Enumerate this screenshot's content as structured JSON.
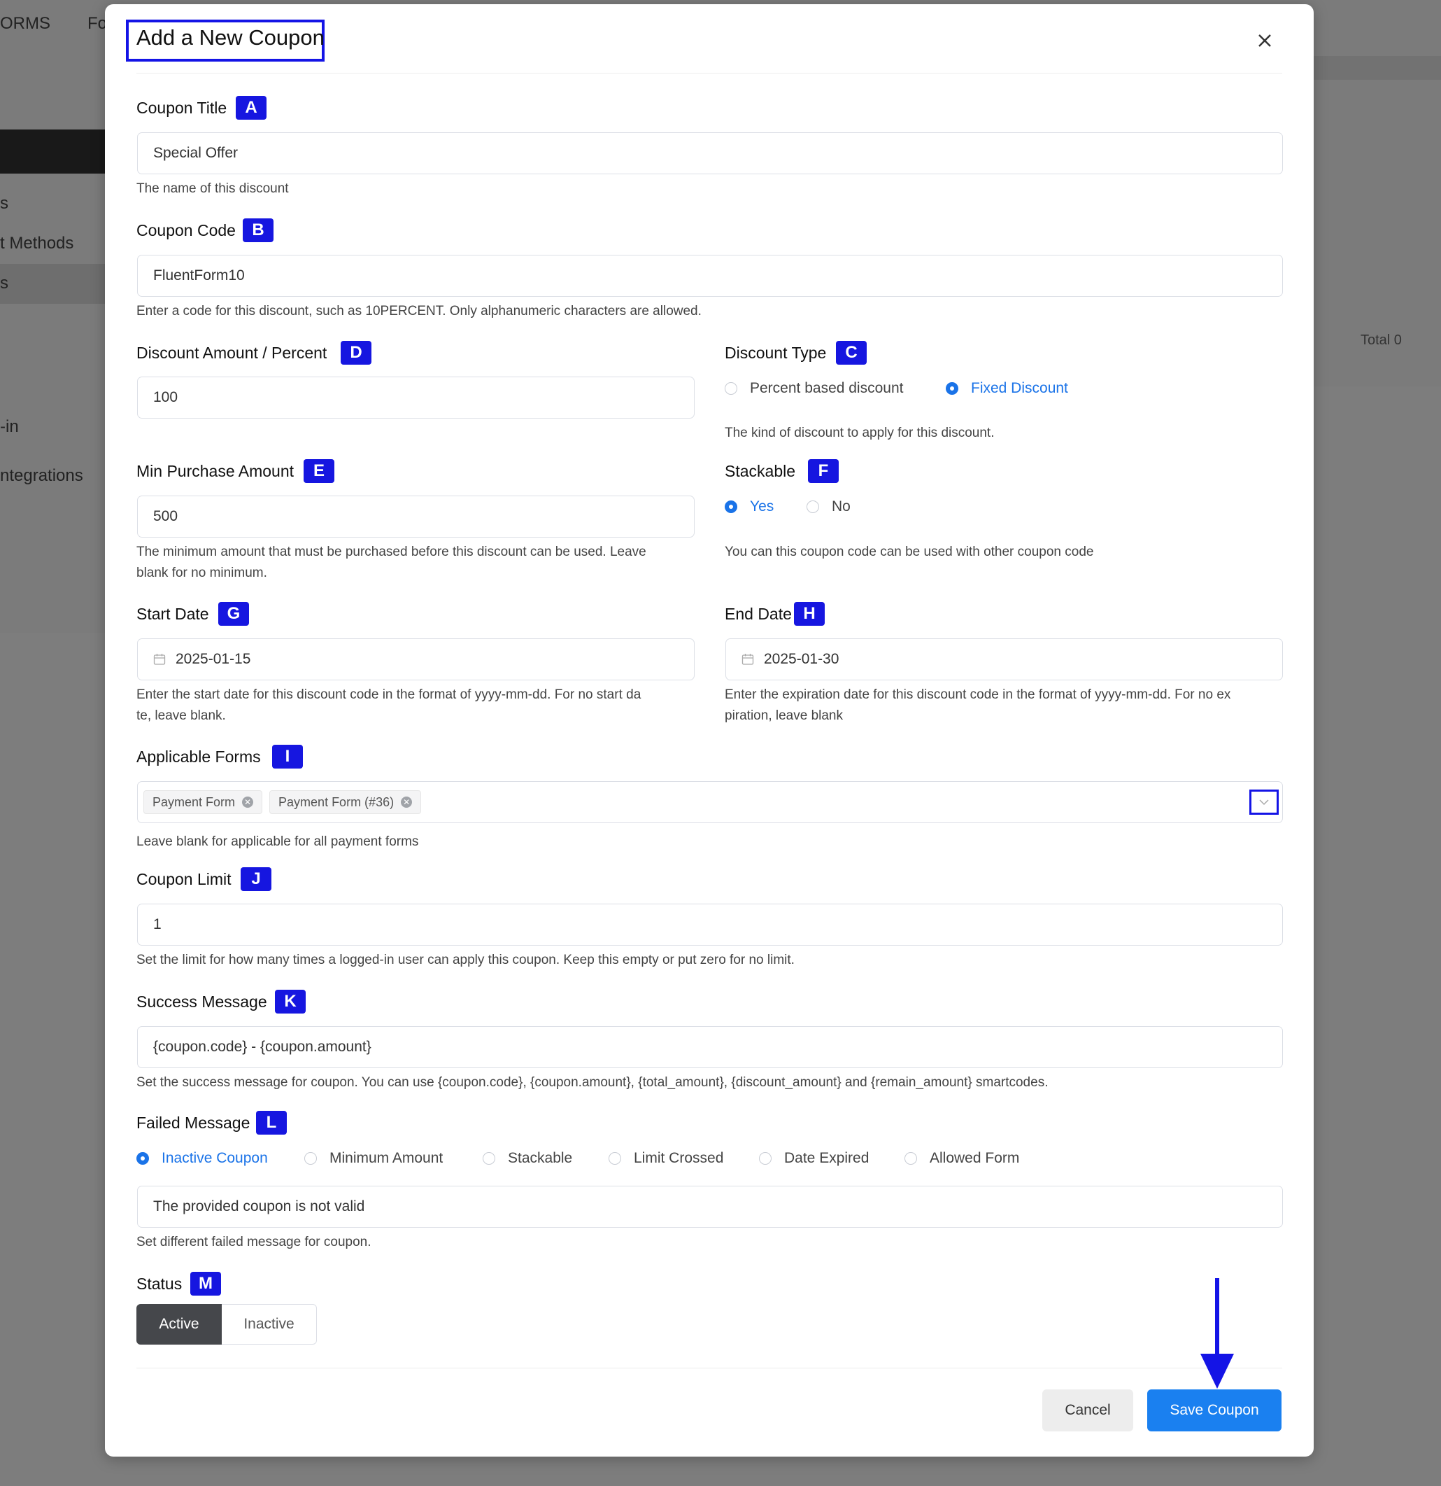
{
  "background": {
    "top_nav": [
      "ORMS",
      "Fo"
    ],
    "sidebar_items": [
      "s",
      "t Methods",
      "s",
      "-in",
      "ntegrations"
    ],
    "total_text": "Total 0"
  },
  "modal": {
    "title": "Add a New Coupon",
    "close_icon": "close-icon",
    "fields": {
      "coupon_title": {
        "label": "Coupon Title",
        "badge": "A",
        "value": "Special Offer",
        "help": "The name of this discount"
      },
      "coupon_code": {
        "label": "Coupon Code",
        "badge": "B",
        "value": "FluentForm10",
        "help": "Enter a code for this discount, such as 10PERCENT. Only alphanumeric characters are allowed."
      },
      "discount_amount": {
        "label": "Discount Amount / Percent",
        "badge": "D",
        "value": "100"
      },
      "discount_type": {
        "label": "Discount Type",
        "badge": "C",
        "options": [
          "Percent based discount",
          "Fixed Discount"
        ],
        "selected": "Fixed Discount",
        "help": "The kind of discount to apply for this discount."
      },
      "min_purchase": {
        "label": "Min Purchase Amount",
        "badge": "E",
        "value": "500",
        "help_line1": "The minimum amount that must be purchased before this discount can be used. Leave",
        "help_line2": "blank for no minimum."
      },
      "stackable": {
        "label": "Stackable",
        "badge": "F",
        "options": [
          "Yes",
          "No"
        ],
        "selected": "Yes",
        "help": "You can this coupon code can be used with other coupon code"
      },
      "start_date": {
        "label": "Start Date",
        "badge": "G",
        "value": "2025-01-15",
        "help_line1": "Enter the start date for this discount code in the format of yyyy-mm-dd. For no start da",
        "help_line2": "te, leave blank."
      },
      "end_date": {
        "label": "End Date",
        "badge": "H",
        "value": "2025-01-30",
        "help_line1": "Enter the expiration date for this discount code in the format of yyyy-mm-dd. For no ex",
        "help_line2": "piration, leave blank"
      },
      "applicable_forms": {
        "label": "Applicable Forms",
        "badge": "I",
        "tags": [
          "Payment Form",
          "Payment Form (#36)"
        ],
        "help": "Leave blank for applicable for all payment forms"
      },
      "coupon_limit": {
        "label": "Coupon Limit",
        "badge": "J",
        "value": "1",
        "help": "Set the limit for how many times a logged-in user can apply this coupon. Keep this empty or put zero for no limit."
      },
      "success_message": {
        "label": "Success Message",
        "badge": "K",
        "value": "{coupon.code} - {coupon.amount}",
        "help": "Set the success message for coupon. You can use {coupon.code}, {coupon.amount}, {total_amount}, {discount_amount} and {remain_amount} smartcodes."
      },
      "failed_message": {
        "label": "Failed Message",
        "badge": "L",
        "options": [
          "Inactive Coupon",
          "Minimum Amount",
          "Stackable",
          "Limit Crossed",
          "Date Expired",
          "Allowed Form"
        ],
        "selected": "Inactive Coupon",
        "value": "The provided coupon is not valid",
        "help": "Set different failed message for coupon."
      },
      "status": {
        "label": "Status",
        "badge": "M",
        "options": [
          "Active",
          "Inactive"
        ],
        "selected": "Active"
      }
    },
    "footer": {
      "cancel_label": "Cancel",
      "save_label": "Save Coupon"
    }
  },
  "colors": {
    "accent": "#1a73e8",
    "badge": "#1616e0",
    "annotation": "#1414e6",
    "primary_button": "#1a80f0"
  }
}
